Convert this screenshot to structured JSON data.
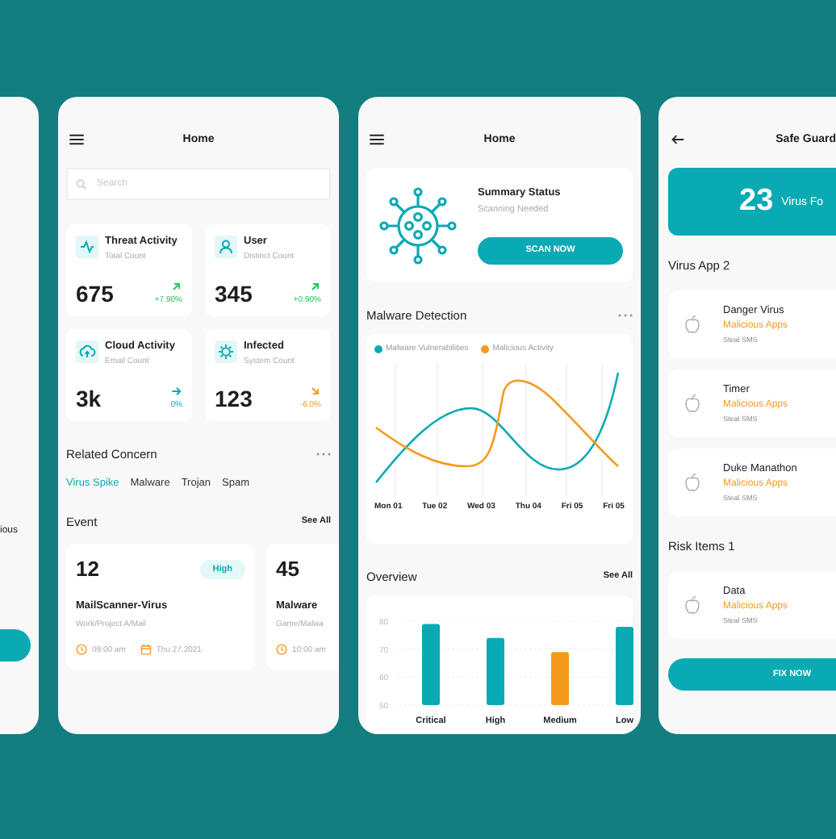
{
  "left_screen": {
    "text": "ious"
  },
  "home_screen": {
    "title": "Home",
    "search": {
      "placeholder": "Search"
    },
    "stats": [
      {
        "title": "Threat Activity",
        "subtitle": "Total Count",
        "value": "675",
        "change": "+7.90%",
        "kind": "up"
      },
      {
        "title": "User",
        "subtitle": "Distinct Count",
        "value": "345",
        "change": "+0.90%",
        "kind": "up"
      },
      {
        "title": "Cloud Activity",
        "subtitle": "Email Count",
        "value": "3k",
        "change": "0%",
        "kind": "flat"
      },
      {
        "title": "Infected",
        "subtitle": "System Count",
        "value": "123",
        "change": "-6.0%",
        "kind": "down"
      }
    ],
    "related": {
      "title": "Related Concern",
      "chips": [
        {
          "label": "Virus Spike",
          "selected": true
        },
        {
          "label": "Malware",
          "selected": false
        },
        {
          "label": "Trojan",
          "selected": false
        },
        {
          "label": "Spam",
          "selected": false
        }
      ]
    },
    "events": {
      "title": "Event",
      "see_all": "See All",
      "cards": [
        {
          "count": "12",
          "badge": "High",
          "title": "MailScanner-Virus",
          "path": "Work/Project A/Mail",
          "time": "09:00 am",
          "date": "Thu 27.2021"
        },
        {
          "count": "45",
          "title": "Malware",
          "path": "Game/Malwa",
          "time": "10:00 am"
        }
      ]
    }
  },
  "detection_screen": {
    "title": "Home",
    "summary": {
      "title": "Summary Status",
      "subtitle": "Scanning Needed",
      "button": "SCAN NOW"
    },
    "detection": {
      "title": "Malware Detection",
      "legend": [
        {
          "label": "Malware Vulnerabilities",
          "color": "#0aaab4"
        },
        {
          "label": "Malicious Activity",
          "color": "#f39a1e"
        }
      ],
      "x_labels": [
        "Mon 01",
        "Tue 02",
        "Wed 03",
        "Thu 04",
        "Fri 05",
        "Fri 05"
      ]
    },
    "overview": {
      "title": "Overview",
      "see_all": "See All",
      "chart_data": {
        "type": "bar",
        "categories": [
          "Critical",
          "High",
          "Medium",
          "Low"
        ],
        "values": [
          79,
          74,
          69,
          78
        ],
        "colors": [
          "#0aaab4",
          "#0aaab4",
          "#f39a1e",
          "#0aaab4"
        ],
        "ylim": [
          50,
          80
        ],
        "yticks": [
          50,
          60,
          70,
          80
        ]
      }
    }
  },
  "safe_guard_screen": {
    "title": "Safe Guard",
    "banner": {
      "count": "23",
      "label": "Virus Fo"
    },
    "sections": [
      {
        "title": "Virus App 2",
        "items": [
          {
            "name": "Danger Virus",
            "category": "Malicious Apps",
            "detail": "Steal SMS"
          },
          {
            "name": "Timer",
            "category": "Malicious Apps",
            "detail": "Steal SMS"
          },
          {
            "name": "Duke Manathon",
            "category": "Malicious Apps",
            "detail": "Steal SMS"
          }
        ]
      },
      {
        "title": "Risk Items 1",
        "items": [
          {
            "name": "Data",
            "category": "Malicious Apps",
            "detail": "Steal SMS"
          }
        ]
      }
    ],
    "button": "FIX NOW"
  }
}
